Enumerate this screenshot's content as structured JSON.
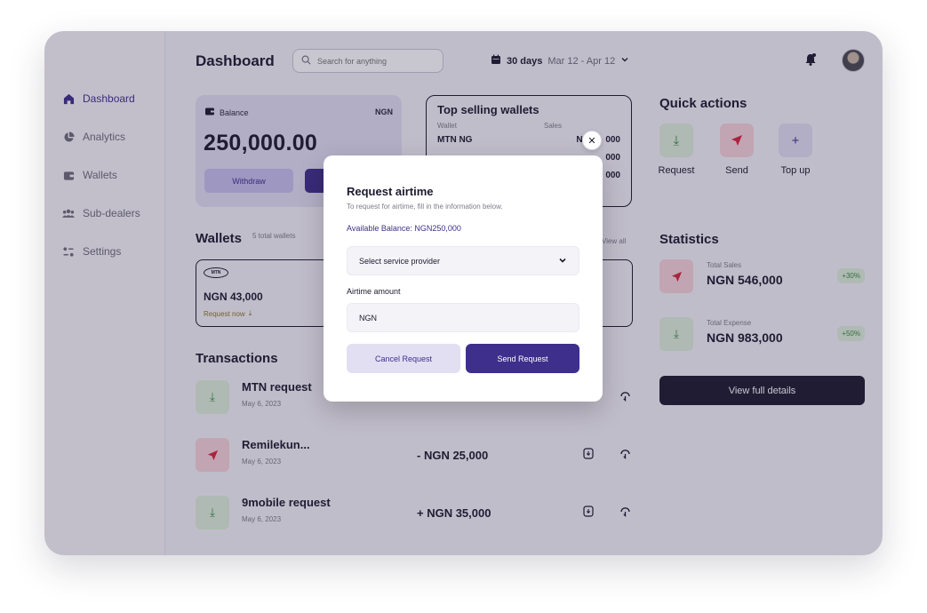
{
  "sidebar": {
    "items": [
      {
        "label": "Dashboard",
        "icon": "home-icon",
        "active": true
      },
      {
        "label": "Analytics",
        "icon": "pie-chart-icon",
        "active": false
      },
      {
        "label": "Wallets",
        "icon": "wallet-icon",
        "active": false
      },
      {
        "label": "Sub-dealers",
        "icon": "users-icon",
        "active": false
      },
      {
        "label": "Settings",
        "icon": "settings-icon",
        "active": false
      }
    ]
  },
  "header": {
    "title": "Dashboard",
    "search_placeholder": "Search for anything",
    "date_bold": "30 days",
    "date_range": "Mar 12 - Apr 12"
  },
  "balance": {
    "label": "Balance",
    "currency": "NGN",
    "amount": "250,000.00",
    "withdraw_label": "Withdraw",
    "topup_label": ""
  },
  "top_selling": {
    "title": "Top selling wallets",
    "col_wallet": "Wallet",
    "col_sales": "Sales",
    "rows": [
      {
        "wallet": "MTN NG",
        "sales": "NGN ",
        "tail": "000"
      },
      {
        "wallet": "",
        "sales": "",
        "tail": "000"
      },
      {
        "wallet": "",
        "sales": "",
        "tail": "000"
      }
    ]
  },
  "quick_actions": {
    "title": "Quick actions",
    "items": [
      {
        "label": "Request",
        "icon": "download-icon",
        "glyph": "⤓"
      },
      {
        "label": "Send",
        "icon": "send-icon",
        "glyph": "➤"
      },
      {
        "label": "Top up",
        "icon": "plus-icon",
        "glyph": "+"
      }
    ]
  },
  "wallets": {
    "title": "Wallets",
    "count": "5 total wallets",
    "view_all": "View all",
    "card": {
      "logo": "MTN",
      "amount": "NGN 43,000",
      "request": "Request now"
    }
  },
  "transactions": {
    "title": "Transactions",
    "rows": [
      {
        "name": "MTN request",
        "date": "May 6, 2023",
        "amount": "",
        "type": "request"
      },
      {
        "name": "Remilekun...",
        "date": "May 6, 2023",
        "amount": "- NGN 25,000",
        "type": "send"
      },
      {
        "name": "9mobile request",
        "date": "May 6, 2023",
        "amount": "+ NGN 35,000",
        "type": "request"
      }
    ]
  },
  "statistics": {
    "title": "Statistics",
    "items": [
      {
        "label": "Total Sales",
        "value": "NGN 546,000",
        "badge": "+30%",
        "icon": "send-icon"
      },
      {
        "label": "Total Expense",
        "value": "NGN 983,000",
        "badge": "+50%",
        "icon": "download-icon"
      }
    ],
    "view_details": "View full details"
  },
  "modal": {
    "title": "Request airtime",
    "subtitle": "To request for airtime, fill in the information below.",
    "balance": "Available Balance: NGN250,000",
    "provider_placeholder": "Select service provider",
    "amount_label": "Airtime amount",
    "amount_value": "NGN",
    "cancel_label": "Cancel Request",
    "send_label": "Send Request",
    "close_glyph": "✕"
  },
  "colors": {
    "primary": "#3e2f8c",
    "dark": "#1b1a2e",
    "green_soft": "#dcefd9",
    "red_soft": "#f6d3d8",
    "red": "#d8243a"
  }
}
